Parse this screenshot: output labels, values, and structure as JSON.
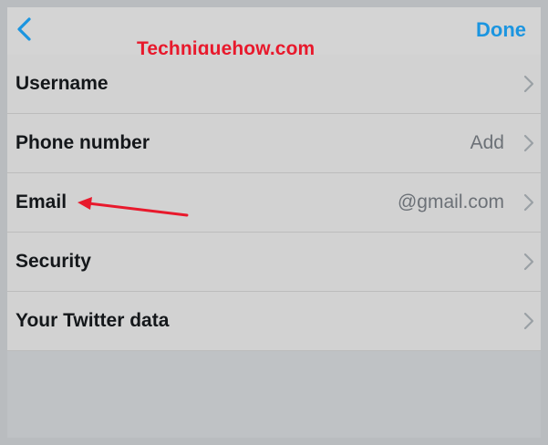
{
  "navbar": {
    "back_icon": "chevron-left-icon",
    "done_label": "Done",
    "accent_color": "#1b95e0"
  },
  "watermark": {
    "text": "Techniquehow.com",
    "color": "#e8192c"
  },
  "settings": {
    "rows": [
      {
        "label": "Username",
        "value": ""
      },
      {
        "label": "Phone number",
        "value": "Add"
      },
      {
        "label": "Email",
        "value": "@gmail.com"
      },
      {
        "label": "Security",
        "value": ""
      },
      {
        "label": "Your Twitter data",
        "value": ""
      }
    ],
    "row_icon": "chevron-right-icon"
  },
  "annotation": {
    "icon": "red-arrow-icon",
    "color": "#e8192c",
    "points_to": "Email"
  }
}
